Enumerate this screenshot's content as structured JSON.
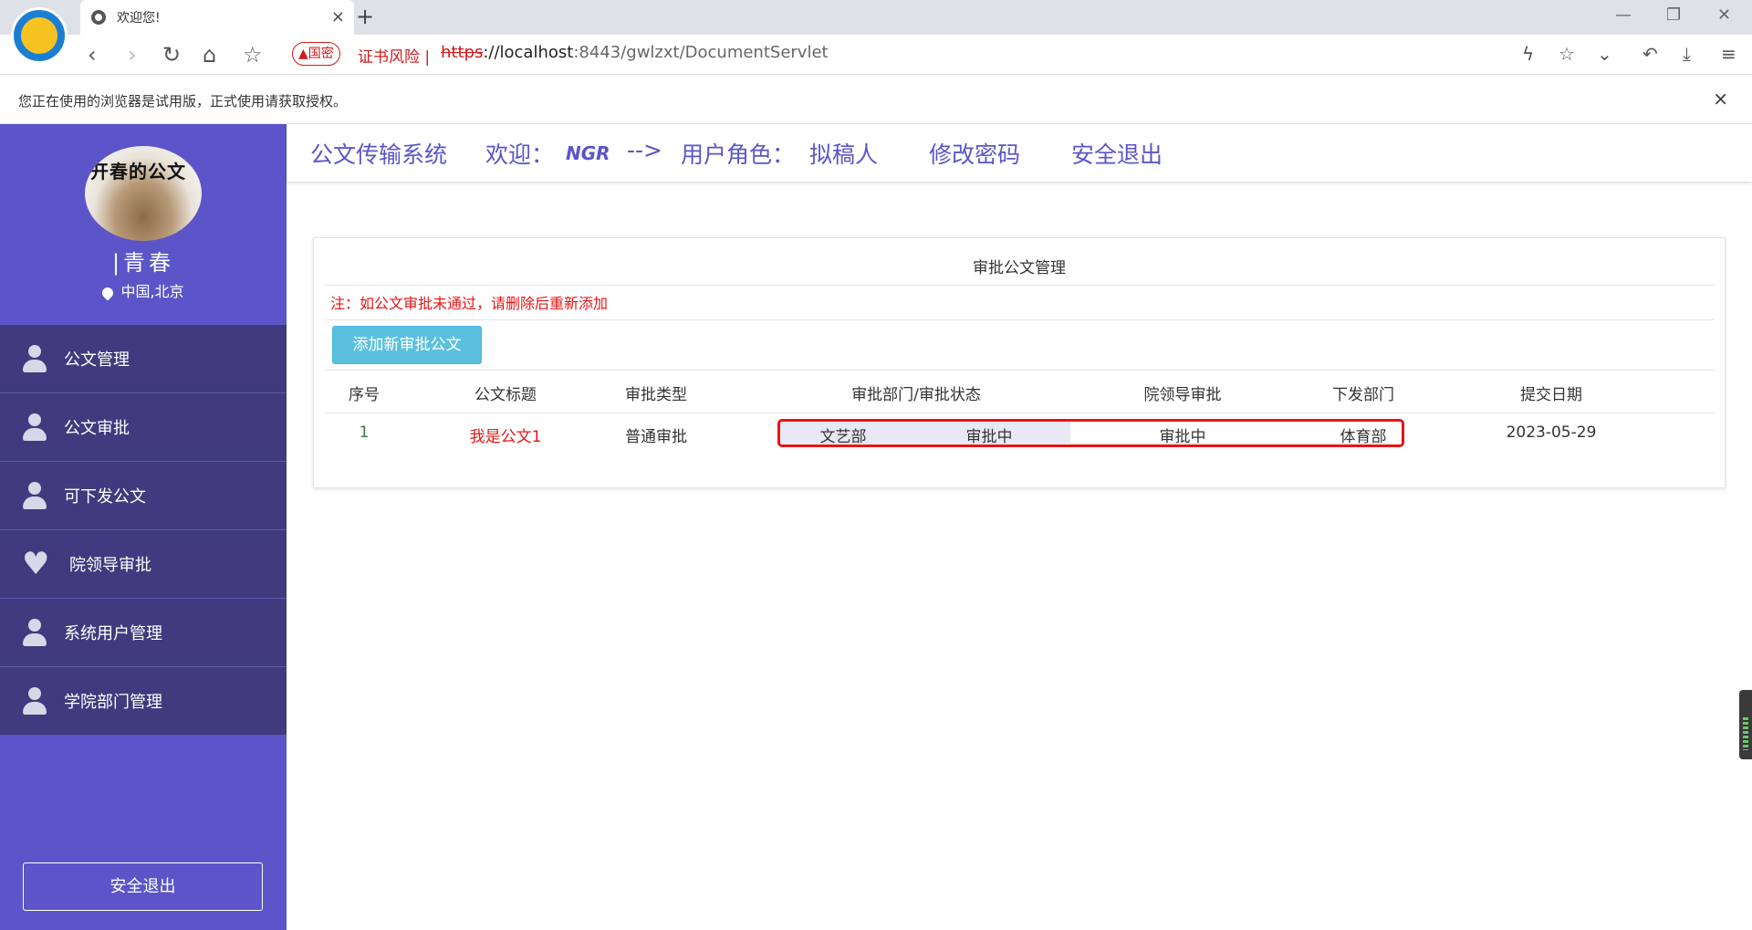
{
  "browser": {
    "tab_title": "欢迎您!",
    "tab_close": "×",
    "new_tab": "+",
    "security_badge": "▲国密",
    "security_text": "证书风险 |",
    "url_proto": "https",
    "url_host": "://localhost",
    "url_path": ":8443/gwlzxt/DocumentServlet",
    "notice": "您正在使用的浏览器是试用版，正式使用请获取授权。",
    "notice_close": "×"
  },
  "sidebar": {
    "avatar_text": "开春的公文",
    "user_name": "|青春",
    "location": "中国,北京",
    "items": [
      {
        "label": "公文管理",
        "icon": "user-icon"
      },
      {
        "label": "公文审批",
        "icon": "user-icon"
      },
      {
        "label": "可下发公文",
        "icon": "user-icon"
      },
      {
        "label": "院领导审批",
        "icon": "heart-icon"
      },
      {
        "label": "系统用户管理",
        "icon": "user-icon"
      },
      {
        "label": "学院部门管理",
        "icon": "user-icon"
      }
    ],
    "logout": "安全退出"
  },
  "topnav": {
    "system_name": "公文传输系统",
    "welcome": "欢迎：",
    "username": "NGR",
    "arrow": "-->",
    "role_label": "用户角色：",
    "role": "拟稿人",
    "change_password": "修改密码",
    "logout": "安全退出"
  },
  "panel": {
    "title": "审批公文管理",
    "note": "注：如公文审批未通过，请删除后重新添加",
    "add_button": "添加新审批公文",
    "columns": [
      "序号",
      "公文标题",
      "审批类型",
      "审批部门/审批状态",
      "院领导审批",
      "下发部门",
      "提交日期"
    ],
    "rows": [
      {
        "index": "1",
        "title": "我是公文1",
        "type": "普通审批",
        "dept": "文艺部",
        "dept_status": "审批中",
        "leader_status": "审批中",
        "issue_dept": "体育部",
        "date": "2023-05-29"
      }
    ]
  }
}
